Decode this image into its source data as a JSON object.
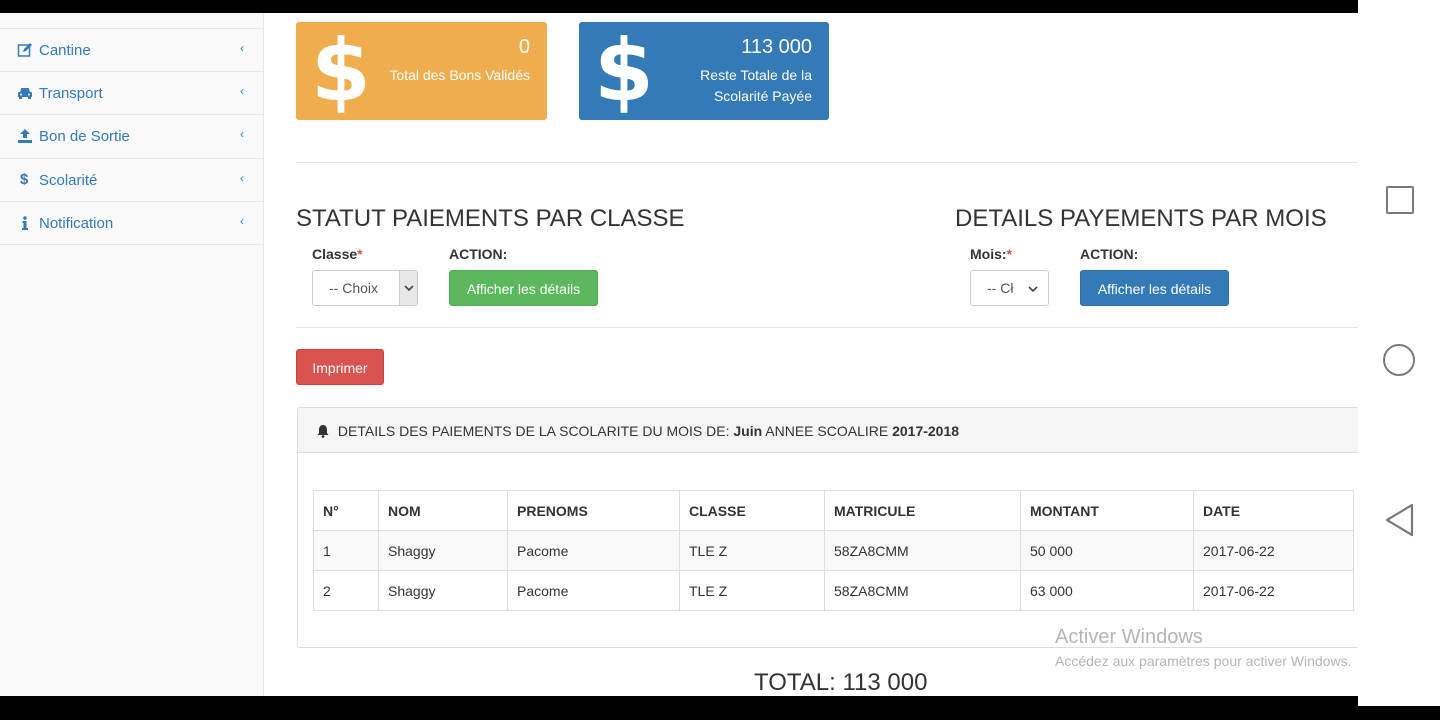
{
  "sidebar": {
    "items": [
      {
        "label": "Cantine",
        "icon": "edit-icon"
      },
      {
        "label": "Transport",
        "icon": "car-icon"
      },
      {
        "label": "Bon de Sortie",
        "icon": "upload-icon"
      },
      {
        "label": "Scolarité",
        "icon": "dollar-icon"
      },
      {
        "label": "Notification",
        "icon": "info-icon"
      }
    ],
    "chevron": "‹"
  },
  "stats": {
    "bons": {
      "value": "0",
      "label": "Total des Bons Validés",
      "color": "#f0ad4e"
    },
    "reste": {
      "value": "113 000",
      "label_line1": "Reste Totale de la",
      "label_line2": "Scolarité Payée",
      "color": "#337ab7"
    },
    "symbol": "$"
  },
  "statut": {
    "title": "STATUT PAIEMENTS PAR CLASSE",
    "classe_label": "Classe",
    "required_mark": "*",
    "action_label": "ACTION:",
    "select_value": "-- Choix",
    "button": "Afficher les détails"
  },
  "details": {
    "title": "DETAILS PAYEMENTS PAR MOIS",
    "mois_label": "Mois:",
    "required_mark": "*",
    "action_label": "ACTION:",
    "select_value": "-- Cł",
    "button": "Afficher les détails"
  },
  "print_button": "Imprimer",
  "panel": {
    "prefix": "DETAILS DES PAIEMENTS DE LA SCOLARITE DU MOIS DE:",
    "month": "Juin",
    "mid": "ANNEE SCOALIRE",
    "year": "2017-2018"
  },
  "table": {
    "headers": [
      "N°",
      "NOM",
      "PRENOMS",
      "CLASSE",
      "MATRICULE",
      "MONTANT",
      "DATE"
    ],
    "rows": [
      [
        "1",
        "Shaggy",
        "Pacome",
        "TLE Z",
        "58ZA8CMM",
        "50 000",
        "2017-06-22"
      ],
      [
        "2",
        "Shaggy",
        "Pacome",
        "TLE Z",
        "58ZA8CMM",
        "63 000",
        "2017-06-22"
      ]
    ]
  },
  "total": "TOTAL: 113 000",
  "watermark": {
    "line1": "Activer Windows",
    "line2": "Accédez aux paramètres pour activer Windows."
  },
  "colors": {
    "primary": "#337ab7",
    "success": "#5cb85c",
    "danger": "#d9534f",
    "warning": "#f0ad4e"
  }
}
